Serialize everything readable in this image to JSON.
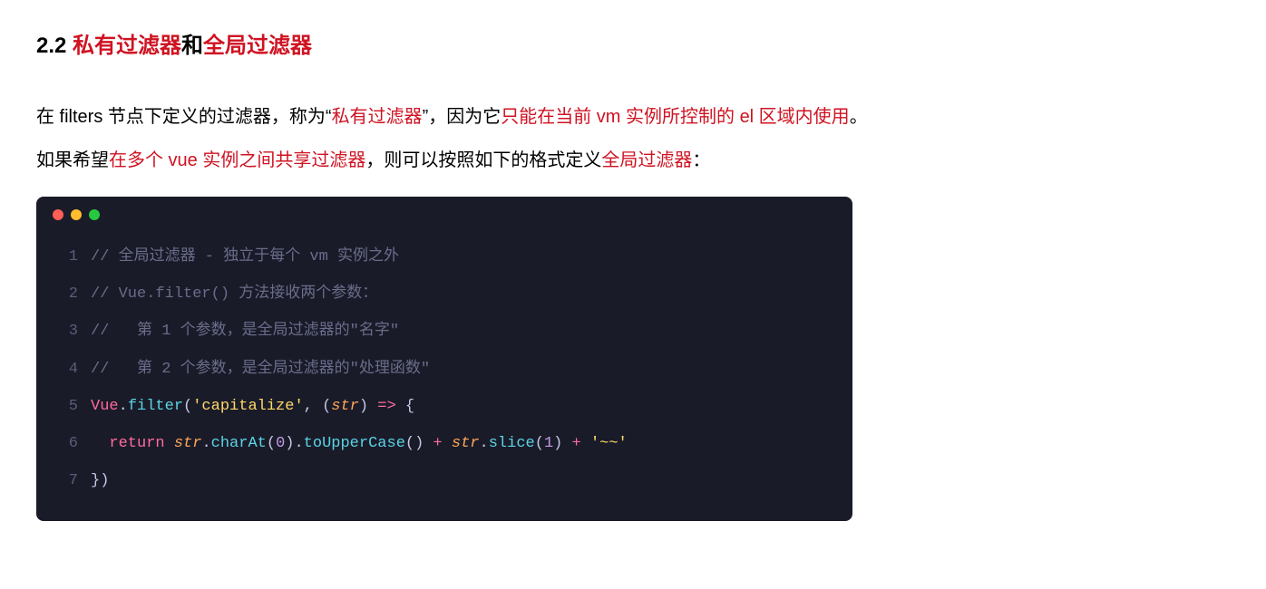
{
  "heading": {
    "num": "2.2 ",
    "red1": "私有过滤器",
    "black": "和",
    "red2": "全局过滤器"
  },
  "paragraph": {
    "p1_a": "在 filters 节点下定义的过滤器，称为“",
    "p1_b": "私有过滤器",
    "p1_c": "”，因为它",
    "p1_d": "只能在当前 vm 实例所控制的 el 区域内使用",
    "p1_e": "。",
    "p2_a": "如果希望",
    "p2_b": "在多个 vue 实例之间共享过滤器",
    "p2_c": "，则可以按照如下的格式定义",
    "p2_d": "全局过滤器",
    "p2_e": "："
  },
  "code": {
    "lines": {
      "n1": "1",
      "n2": "2",
      "n3": "3",
      "n4": "4",
      "n5": "5",
      "n6": "6",
      "n7": "7"
    },
    "l1": "// 全局过滤器 - 独立于每个 vm 实例之外",
    "l2": "// Vue.filter() 方法接收两个参数：",
    "l3": "//   第 1 个参数，是全局过滤器的\"名字\"",
    "l4": "//   第 2 个参数，是全局过滤器的\"处理函数\"",
    "l5": {
      "obj": "Vue",
      "dot1": ".",
      "method": "filter",
      "p1": "(",
      "str": "'capitalize'",
      "comma": ", ",
      "p2": "(",
      "param": "str",
      "p3": ") ",
      "arrow": "=>",
      "p4": " {"
    },
    "l6": {
      "indent": "  ",
      "kw": "return",
      "sp1": " ",
      "param1": "str",
      "dot1": ".",
      "m1": "charAt",
      "p1": "(",
      "num1": "0",
      "p2": ").",
      "m2": "toUpperCase",
      "p3": "() ",
      "op1": "+",
      "sp2": " ",
      "param2": "str",
      "dot2": ".",
      "m3": "slice",
      "p4": "(",
      "num2": "1",
      "p5": ") ",
      "op2": "+",
      "sp3": " ",
      "str": "'~~'"
    },
    "l7": "})"
  }
}
